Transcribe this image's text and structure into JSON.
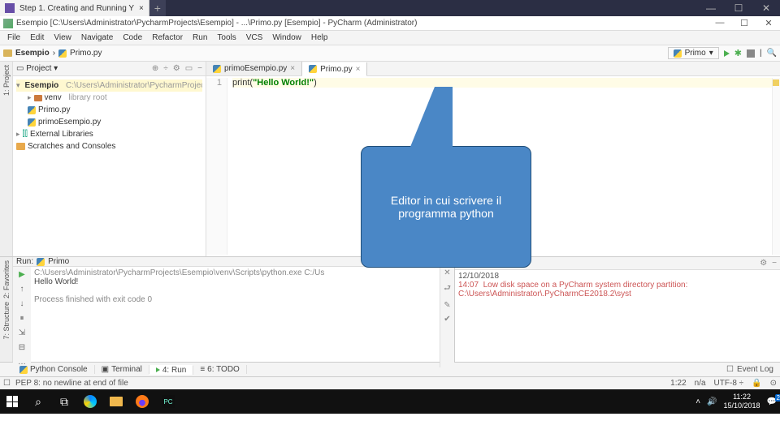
{
  "browser": {
    "tab_title": "Step 1. Creating and Running Y",
    "newtab": "+",
    "ctrl_min": "—",
    "ctrl_max": "☐",
    "ctrl_close": "✕"
  },
  "titlebar": {
    "text": "Esempio [C:\\Users\\Administrator\\PycharmProjects\\Esempio] - ...\\Primo.py [Esempio] - PyCharm (Administrator)",
    "min": "—",
    "max": "☐",
    "close": "✕"
  },
  "menu": [
    "File",
    "Edit",
    "View",
    "Navigate",
    "Code",
    "Refactor",
    "Run",
    "Tools",
    "VCS",
    "Window",
    "Help"
  ],
  "breadcrumb": {
    "proj": "Esempio",
    "sep": "›",
    "file": "Primo.py",
    "run_config": "Primo",
    "icons": {
      "run": "▶",
      "debug": "✱",
      "stack": "▤",
      "sep": "|",
      "search": "🔍"
    }
  },
  "projectPanel": {
    "title": "Project",
    "dd": "▾",
    "tools": [
      "⊕",
      "÷",
      "⚙",
      "▭",
      "−"
    ],
    "tree": {
      "root": "Esempio",
      "root_path": "C:\\Users\\Administrator\\PycharmProjects\\Esem",
      "venv": "venv",
      "venv_tag": "library root",
      "f1": "Primo.py",
      "f2": "primoEsempio.py",
      "ext": "External Libraries",
      "scratch": "Scratches and Consoles"
    }
  },
  "editor": {
    "tabs": [
      {
        "name": "primoEsempio.py"
      },
      {
        "name": "Primo.py"
      }
    ],
    "lineno": "1",
    "code_fn": "print",
    "code_paren_o": "(",
    "code_str": "\"Hello World!\"",
    "code_paren_c": ")"
  },
  "callout": {
    "text": "Editor in cui scrivere il programma python"
  },
  "runPanel": {
    "title": "Run:",
    "conf": "Primo",
    "tools": [
      "⇅",
      "−"
    ],
    "out_line1": "C:\\Users\\Administrator\\PycharmProjects\\Esempio\\venv\\Scripts\\python.exe C:/Us",
    "out_hello": "Hello World!",
    "out_end": "Process finished with exit code 0",
    "gutter": [
      "▶",
      "↑",
      "↓",
      "⏸",
      "⇲",
      "⊟",
      "…"
    ],
    "side": [
      "✕",
      "⮐",
      "✎",
      "✔"
    ]
  },
  "eventPanel": {
    "title": "",
    "date": "12/10/2018",
    "warn_time": "14:07",
    "warn": "Low disk space on a PyCharm system directory partition: C:\\Users\\Administrator\\.PyCharmCE2018.2\\syst"
  },
  "tooltabs": {
    "items": [
      "Python Console",
      "Terminal",
      "4: Run",
      "6: TODO"
    ],
    "right": "Event Log"
  },
  "leftGutterTop": {
    "proj": "1: Project"
  },
  "leftGutterBottom": {
    "fav": "2: Favorites",
    "struct": "7: Structure"
  },
  "statusbar": {
    "left_icon": "☐",
    "msg": "PEP 8: no newline at end of file",
    "pos": "1:22",
    "sep": "n/a",
    "enc": "UTF-8 ÷",
    "lock": "🔒",
    "ov": "⊙"
  },
  "taskbar": {
    "tray_arrow": "˄",
    "tray_vol": "🔊",
    "time": "11:22",
    "date": "15/10/2018",
    "notif": "💬",
    "notif_badge": "2"
  }
}
